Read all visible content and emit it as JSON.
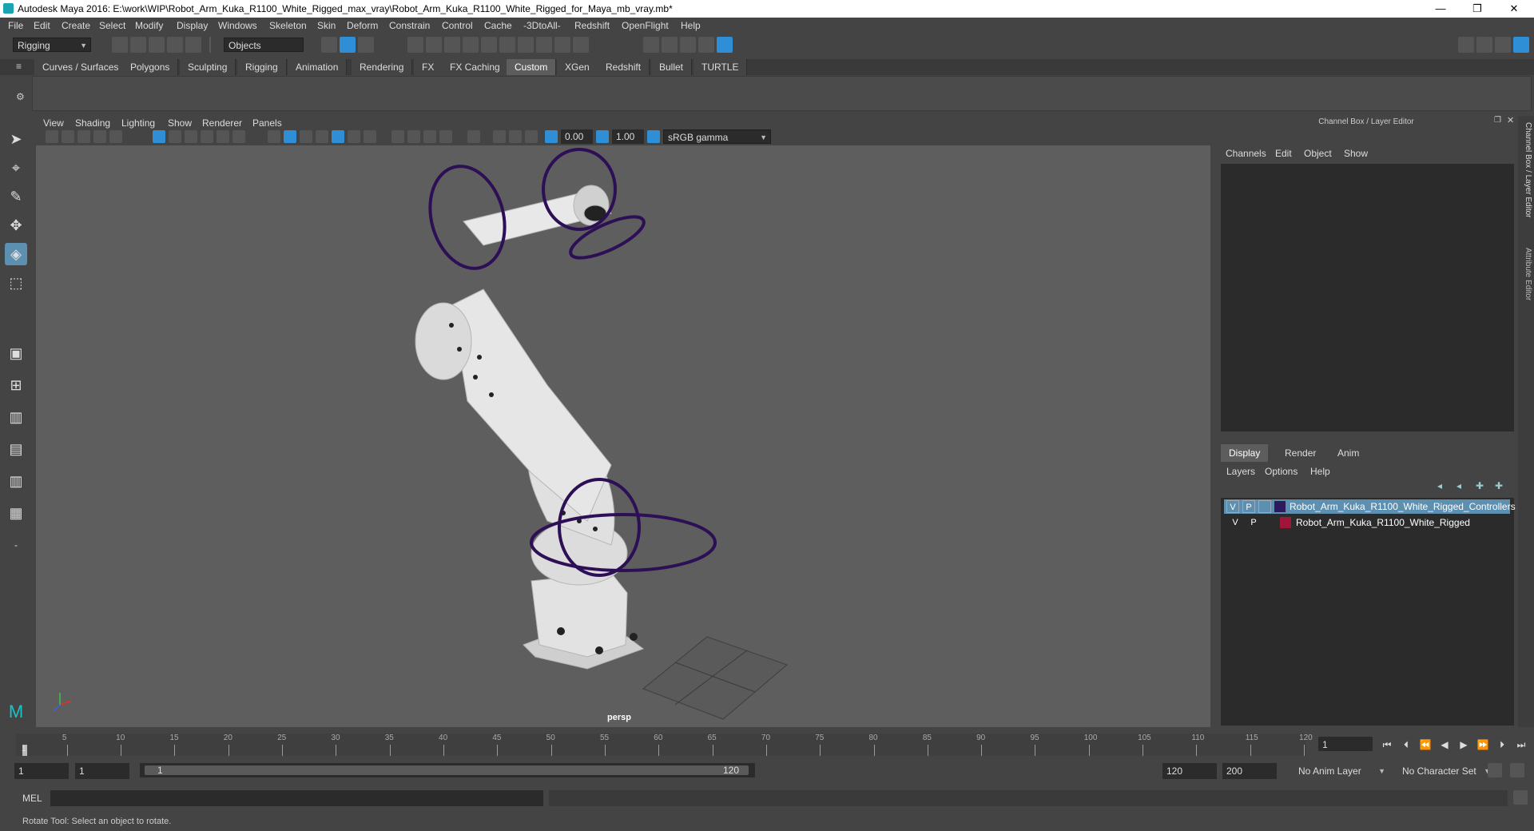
{
  "window": {
    "title": "Autodesk Maya 2016: E:\\work\\WIP\\Robot_Arm_Kuka_R1100_White_Rigged_max_vray\\Robot_Arm_Kuka_R1100_White_Rigged_for_Maya_mb_vray.mb*",
    "min": "—",
    "max": "❐",
    "close": "✕"
  },
  "menubar": [
    "File",
    "Edit",
    "Create",
    "Select",
    "Modify",
    "Display",
    "Windows",
    "Skeleton",
    "Skin",
    "Deform",
    "Constrain",
    "Control",
    "Cache",
    "-3DtoAll-",
    "Redshift",
    "OpenFlight",
    "Help"
  ],
  "statusline": {
    "mode": "Rigging",
    "select_mode": "Objects"
  },
  "shelf": {
    "tabs": [
      "Curves / Surfaces",
      "Polygons",
      "Sculpting",
      "Rigging",
      "Animation",
      "Rendering",
      "FX",
      "FX Caching",
      "Custom",
      "XGen",
      "Redshift",
      "Bullet",
      "TURTLE"
    ],
    "active": "Custom"
  },
  "viewport": {
    "menus": [
      "View",
      "Shading",
      "Lighting",
      "Show",
      "Renderer",
      "Panels"
    ],
    "exposure": "0.00",
    "gamma": "1.00",
    "colorspace": "sRGB gamma",
    "camera": "persp"
  },
  "channelbox": {
    "header": "Channel Box / Layer Editor",
    "menus": [
      "Channels",
      "Edit",
      "Object",
      "Show"
    ]
  },
  "layer_editor": {
    "tabs": [
      "Display",
      "Render",
      "Anim"
    ],
    "active_tab": "Display",
    "menus": [
      "Layers",
      "Options",
      "Help"
    ],
    "layers": [
      {
        "v": "V",
        "p": "P",
        "color": "#2d1a5c",
        "name": "Robot_Arm_Kuka_R1100_White_Rigged_Controllers",
        "selected": true
      },
      {
        "v": "V",
        "p": "P",
        "color": "#a0153a",
        "name": "Robot_Arm_Kuka_R1100_White_Rigged",
        "selected": false
      }
    ]
  },
  "sidetabs": [
    "Channel Box / Layer Editor",
    "Attribute Editor"
  ],
  "timeslider": {
    "labels": [
      "5",
      "10",
      "15",
      "20",
      "25",
      "30",
      "35",
      "40",
      "45",
      "50",
      "55",
      "60",
      "65",
      "70",
      "75",
      "80",
      "85",
      "90",
      "95",
      "100",
      "105",
      "110",
      "115",
      "120"
    ],
    "current_frame_marker": "1",
    "current_frame": "1"
  },
  "range": {
    "start": "1",
    "playback_start": "1",
    "slider_start": "1",
    "slider_end": "120",
    "playback_end": "120",
    "end": "200",
    "anim_layer": "No Anim Layer",
    "character_set": "No Character Set"
  },
  "cmdline": {
    "label": "MEL"
  },
  "helpline": {
    "text": "Rotate Tool: Select an object to rotate."
  }
}
